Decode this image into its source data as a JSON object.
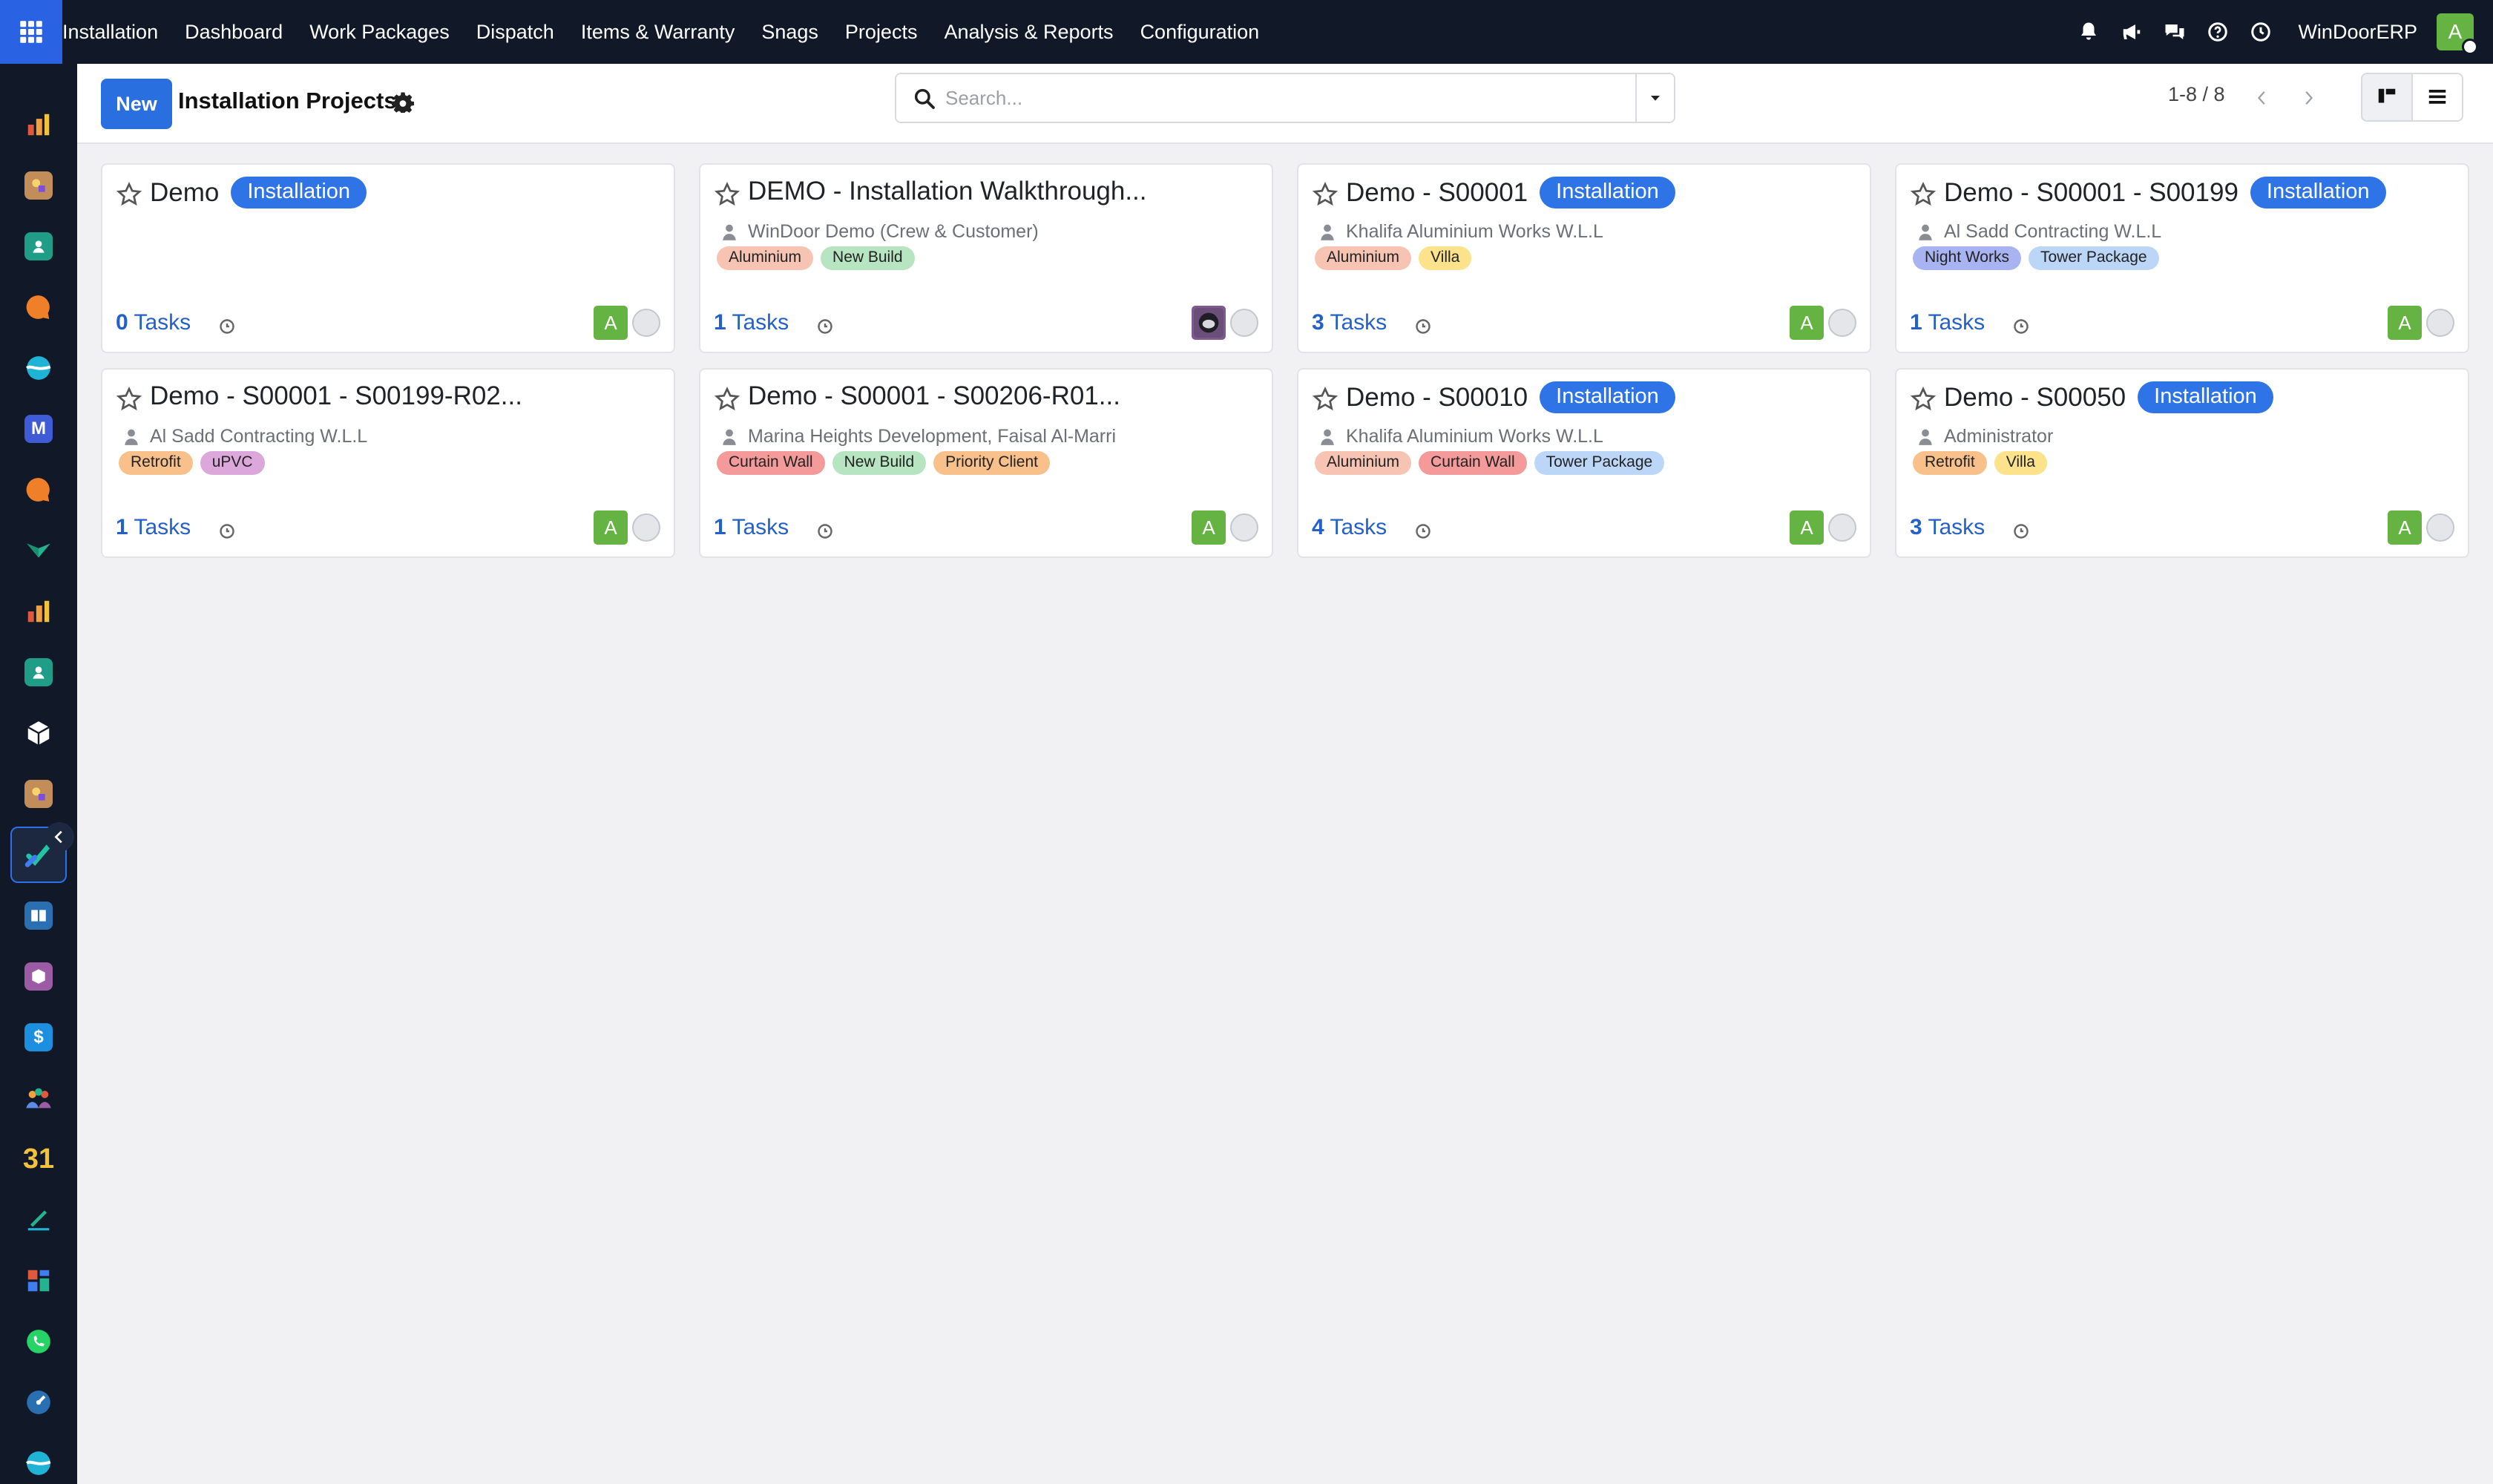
{
  "navbar": {
    "app_name": "Installation",
    "menu": [
      "Dashboard",
      "Work Packages",
      "Dispatch",
      "Items & Warranty",
      "Snags",
      "Projects",
      "Analysis & Reports",
      "Configuration"
    ],
    "company": "WinDoorERP",
    "user_initial": "A",
    "icons": [
      "bell-icon",
      "megaphone-icon",
      "chat-icon",
      "help-icon",
      "clock-icon"
    ]
  },
  "rail": {
    "apps": [
      "sales-app",
      "product-app",
      "contacts-app",
      "discuss-app",
      "crm-app",
      "mail-app",
      "discuss-app-2",
      "inventory-app",
      "sales-app-2",
      "employees-app",
      "packages-app",
      "manufacturing-app",
      "installation-app",
      "documents-app",
      "barcode-app",
      "invoicing-app",
      "team-app",
      "calendar-app",
      "sign-app",
      "dashboards-app",
      "whatsapp-app",
      "timer-app",
      "helpdesk-app"
    ],
    "active_app": "installation-app",
    "calendar_label": "31"
  },
  "control": {
    "new_label": "New",
    "title": "Installation Projects",
    "search_placeholder": "Search...",
    "pager": "1-8 / 8"
  },
  "colors": {
    "navbar_bg": "#111827",
    "primary": "#2a6fe0",
    "stage_badge": "#2f74e6",
    "avatar_green": "#65b443",
    "tasks_link": "#2360c9"
  },
  "cards": [
    {
      "name": "Demo",
      "stage": "Installation",
      "customer": "",
      "tags": [],
      "tasks_count": "0",
      "tasks_label": "Tasks",
      "assignee": "A"
    },
    {
      "name": "DEMO - Installation Walkthrough...",
      "stage": "",
      "customer": "WinDoor Demo (Crew & Customer)",
      "tags": [
        {
          "label": "Aluminium",
          "color": "#f7c4b4"
        },
        {
          "label": "New Build",
          "color": "#b7e5c1"
        }
      ],
      "tasks_count": "1",
      "tasks_label": "Tasks",
      "assignee": ""
    },
    {
      "name": "Demo - S00001",
      "stage": "Installation",
      "customer": "Khalifa Aluminium Works W.L.L",
      "tags": [
        {
          "label": "Aluminium",
          "color": "#f7c4b4"
        },
        {
          "label": "Villa",
          "color": "#fbe28b"
        }
      ],
      "tasks_count": "3",
      "tasks_label": "Tasks",
      "assignee": "A"
    },
    {
      "name": "Demo - S00001 - S00199",
      "stage": "Installation",
      "customer": "Al Sadd Contracting W.L.L",
      "tags": [
        {
          "label": "Night Works",
          "color": "#a8b3f1"
        },
        {
          "label": "Tower Package",
          "color": "#bcd6f7"
        }
      ],
      "tasks_count": "1",
      "tasks_label": "Tasks",
      "assignee": "A"
    },
    {
      "name": "Demo - S00001 - S00199-R02...",
      "stage": "",
      "customer": "Al Sadd Contracting W.L.L",
      "tags": [
        {
          "label": "Retrofit",
          "color": "#f8c08b"
        },
        {
          "label": "uPVC",
          "color": "#dca8dc"
        }
      ],
      "tasks_count": "1",
      "tasks_label": "Tasks",
      "assignee": "A"
    },
    {
      "name": "Demo - S00001 - S00206-R01...",
      "stage": "",
      "customer": "Marina Heights Development, Faisal Al-Marri",
      "tags": [
        {
          "label": "Curtain Wall",
          "color": "#f49a9a"
        },
        {
          "label": "New Build",
          "color": "#b7e5c1"
        },
        {
          "label": "Priority Client",
          "color": "#f8c08b"
        }
      ],
      "tasks_count": "1",
      "tasks_label": "Tasks",
      "assignee": "A"
    },
    {
      "name": "Demo - S00010",
      "stage": "Installation",
      "customer": "Khalifa Aluminium Works W.L.L",
      "tags": [
        {
          "label": "Aluminium",
          "color": "#f7c4b4"
        },
        {
          "label": "Curtain Wall",
          "color": "#f49a9a"
        },
        {
          "label": "Tower Package",
          "color": "#bcd6f7"
        }
      ],
      "tasks_count": "4",
      "tasks_label": "Tasks",
      "assignee": "A"
    },
    {
      "name": "Demo - S00050",
      "stage": "Installation",
      "customer": "Administrator",
      "tags": [
        {
          "label": "Retrofit",
          "color": "#f8c08b"
        },
        {
          "label": "Villa",
          "color": "#fbe28b"
        }
      ],
      "tasks_count": "3",
      "tasks_label": "Tasks",
      "assignee": "A"
    }
  ]
}
